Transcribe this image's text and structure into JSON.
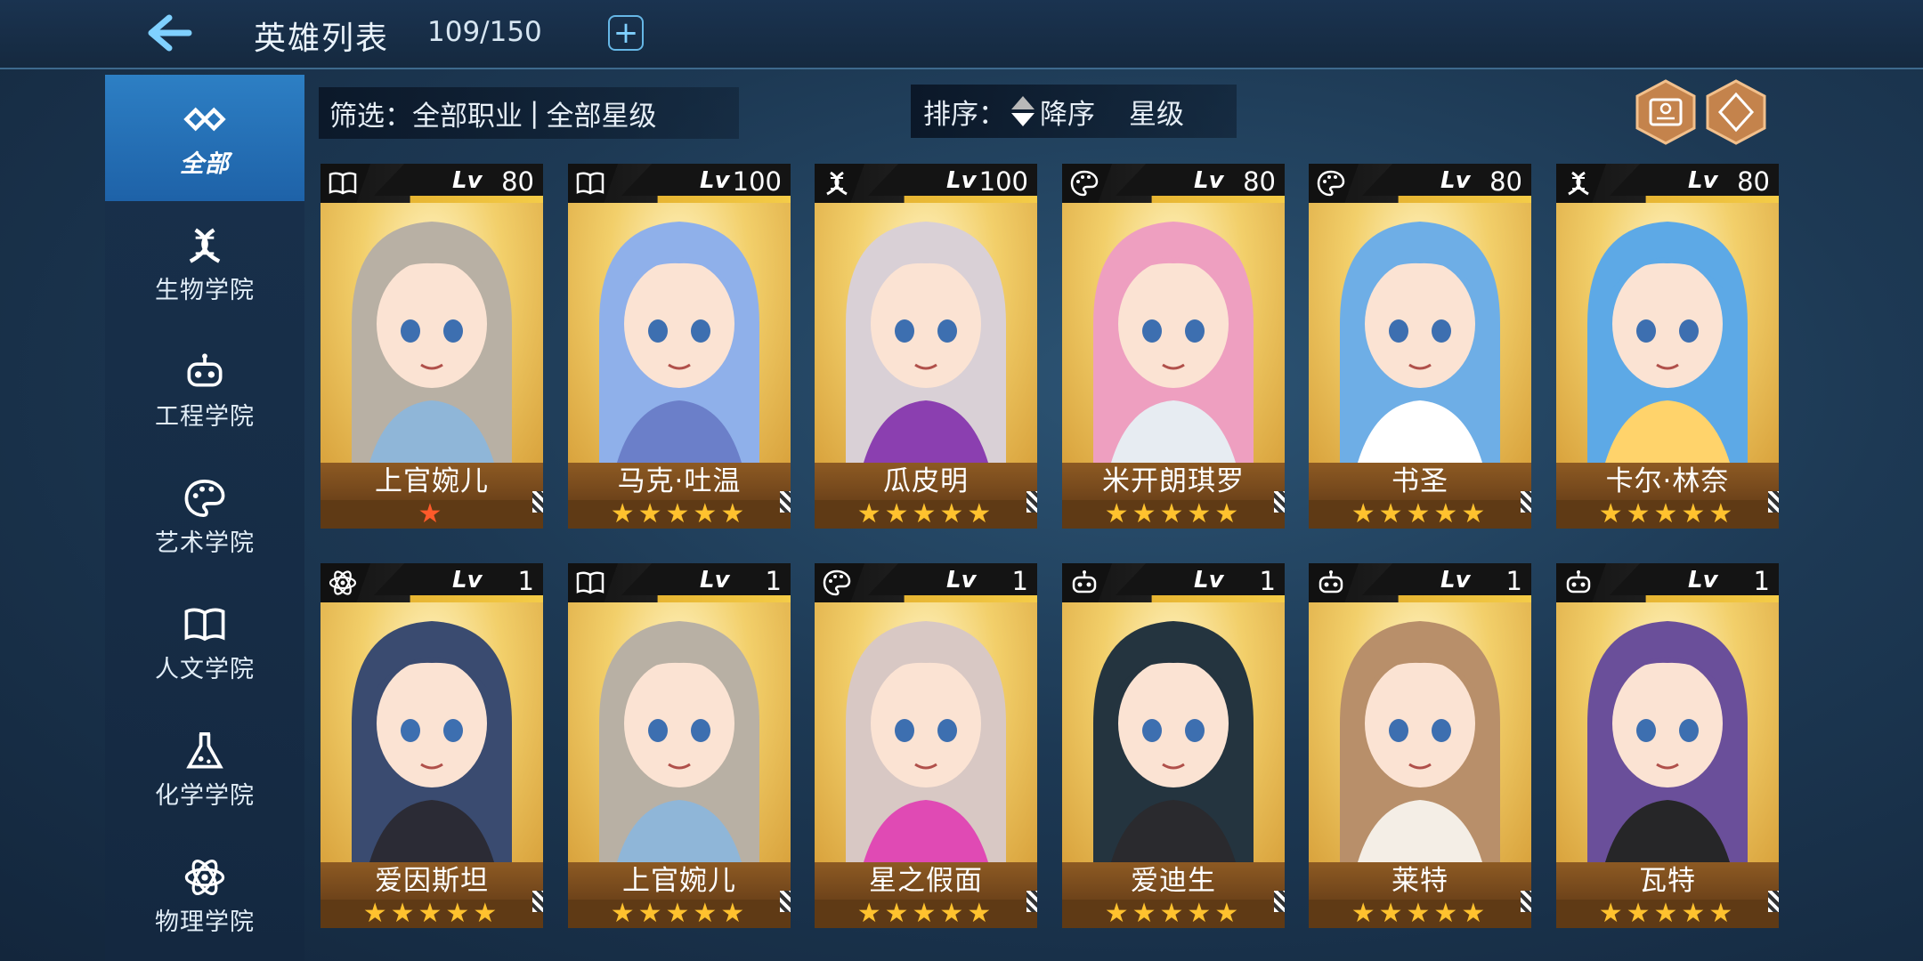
{
  "header": {
    "title": "英雄列表",
    "count": "109/150"
  },
  "sidebar": {
    "items": [
      {
        "label": "全部",
        "icon": "infinity-icon",
        "active": true
      },
      {
        "label": "生物学院",
        "icon": "dna-icon"
      },
      {
        "label": "工程学院",
        "icon": "robot-icon"
      },
      {
        "label": "艺术学院",
        "icon": "palette-icon"
      },
      {
        "label": "人文学院",
        "icon": "book-icon"
      },
      {
        "label": "化学学院",
        "icon": "flask-icon"
      },
      {
        "label": "物理学院",
        "icon": "atom-icon"
      }
    ]
  },
  "filter": {
    "prefix": "筛选：",
    "profession": "全部职业",
    "separator": "|",
    "stars": "全部星级"
  },
  "sort": {
    "prefix": "排序：",
    "order": "降序",
    "key": "星级"
  },
  "toolbar": {
    "left_icon": "id-card-icon",
    "right_icon": "expand-icon"
  },
  "heroes": [
    {
      "name": "上官婉儿",
      "level": "80",
      "class_icon": "book-icon",
      "stars": "★",
      "star_count": 1,
      "hair": "#b8b0a4",
      "accent": "#8fb6d8"
    },
    {
      "name": "马克·吐温",
      "level": "100",
      "class_icon": "book-icon",
      "stars": "★★★★★",
      "star_count": 5,
      "hair": "#8fb0ea",
      "accent": "#6b7fc9"
    },
    {
      "name": "瓜皮明",
      "level": "100",
      "class_icon": "dna-icon",
      "stars": "★★★★★",
      "star_count": 5,
      "hair": "#d9d0d6",
      "accent": "#8b3fb0"
    },
    {
      "name": "米开朗琪罗",
      "level": "80",
      "class_icon": "palette-icon",
      "stars": "★★★★★",
      "star_count": 5,
      "hair": "#ee9fc0",
      "accent": "#e7ecf2"
    },
    {
      "name": "书圣",
      "level": "80",
      "class_icon": "palette-icon",
      "stars": "★★★★★",
      "star_count": 5,
      "hair": "#6eaee6",
      "accent": "#ffffff"
    },
    {
      "name": "卡尔·林奈",
      "level": "80",
      "class_icon": "dna-icon",
      "stars": "★★★★★",
      "star_count": 5,
      "hair": "#5da9e6",
      "accent": "#ffd36b"
    },
    {
      "name": "爱因斯坦",
      "level": "1",
      "class_icon": "atom-icon",
      "stars": "★★★★★",
      "star_count": 5,
      "hair": "#3a4b70",
      "accent": "#2b2b35"
    },
    {
      "name": "上官婉儿",
      "level": "1",
      "class_icon": "book-icon",
      "stars": "★★★★★",
      "star_count": 5,
      "hair": "#b8b0a4",
      "accent": "#8fb6d8"
    },
    {
      "name": "星之假面",
      "level": "1",
      "class_icon": "palette-icon",
      "stars": "★★★★★",
      "star_count": 5,
      "hair": "#d8c8c4",
      "accent": "#e04ab4"
    },
    {
      "name": "爱迪生",
      "level": "1",
      "class_icon": "robot-icon",
      "stars": "★★★★★",
      "star_count": 5,
      "hair": "#24343f",
      "accent": "#2a2a2e"
    },
    {
      "name": "莱特",
      "level": "1",
      "class_icon": "robot-icon",
      "stars": "★★★★★",
      "star_count": 5,
      "hair": "#b88f6a",
      "accent": "#f4eee6"
    },
    {
      "name": "瓦特",
      "level": "1",
      "class_icon": "robot-icon",
      "stars": "★★★★★",
      "star_count": 5,
      "hair": "#6a4f9a",
      "accent": "#262628"
    }
  ]
}
